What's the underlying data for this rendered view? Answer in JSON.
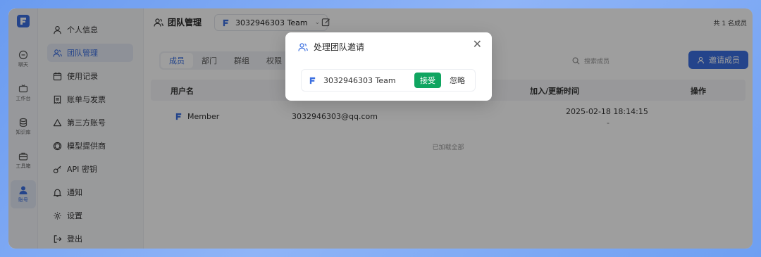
{
  "rail": {
    "items": [
      {
        "label": "聊天",
        "icon": "chat-icon"
      },
      {
        "label": "工作台",
        "icon": "workbench-icon"
      },
      {
        "label": "知识库",
        "icon": "database-icon"
      },
      {
        "label": "工具箱",
        "icon": "toolbox-icon"
      },
      {
        "label": "账号",
        "icon": "user-icon"
      }
    ]
  },
  "sidebar": {
    "items": [
      {
        "label": "个人信息",
        "icon": "user-icon"
      },
      {
        "label": "团队管理",
        "icon": "team-icon"
      },
      {
        "label": "使用记录",
        "icon": "calendar-icon"
      },
      {
        "label": "账单与发票",
        "icon": "receipt-icon"
      },
      {
        "label": "第三方账号",
        "icon": "triangle-icon"
      },
      {
        "label": "模型提供商",
        "icon": "openai-icon"
      },
      {
        "label": "API 密钥",
        "icon": "key-icon"
      },
      {
        "label": "通知",
        "icon": "bell-icon"
      },
      {
        "label": "设置",
        "icon": "gear-icon"
      },
      {
        "label": "登出",
        "icon": "logout-icon"
      }
    ]
  },
  "header": {
    "title": "团队管理",
    "team_name": "3032946303 Team",
    "member_count": "共 1 名成员"
  },
  "tabs": [
    "成员",
    "部门",
    "群组",
    "权限"
  ],
  "search": {
    "placeholder": "搜索成员"
  },
  "invite_button": "邀请成员",
  "table": {
    "columns": {
      "username": "用户名",
      "joined": "加入/更新时间",
      "actions": "操作"
    },
    "rows": [
      {
        "name": "Member",
        "email": "3032946303@qq.com",
        "time": "2025-02-18 18:14:15",
        "sub": "-"
      }
    ],
    "footer": "已加载全部"
  },
  "modal": {
    "title": "处理团队邀请",
    "team_name": "3032946303 Team",
    "accept": "接受",
    "ignore": "忽略"
  },
  "colors": {
    "accent": "#3b6fe0",
    "accept": "#10a560"
  }
}
